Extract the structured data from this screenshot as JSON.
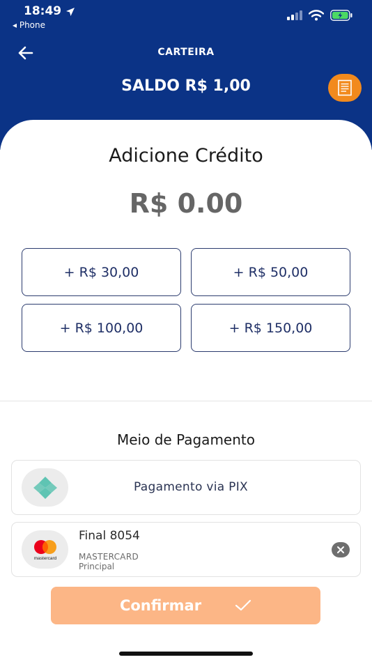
{
  "status_bar": {
    "time": "18:49",
    "back_label": "◂ Phone"
  },
  "header": {
    "title": "CARTEIRA",
    "balance": "SALDO R$ 1,00"
  },
  "credit": {
    "title": "Adicione Crédito",
    "amount": "R$ 0.00",
    "options": [
      "+ R$ 30,00",
      "+ R$ 50,00",
      "+ R$ 100,00",
      "+ R$ 150,00"
    ]
  },
  "payment": {
    "title": "Meio de Pagamento",
    "pix_label": "Pagamento via PIX",
    "card": {
      "final": "Final 8054",
      "brand": "MASTERCARD",
      "tag": "Principal",
      "logo_text": "mastercard"
    }
  },
  "confirm_label": "Confirmar",
  "colors": {
    "header": "#0b3386",
    "accent": "#f28a1d",
    "confirm": "#fcb686",
    "pix": "#5fc4b3"
  }
}
